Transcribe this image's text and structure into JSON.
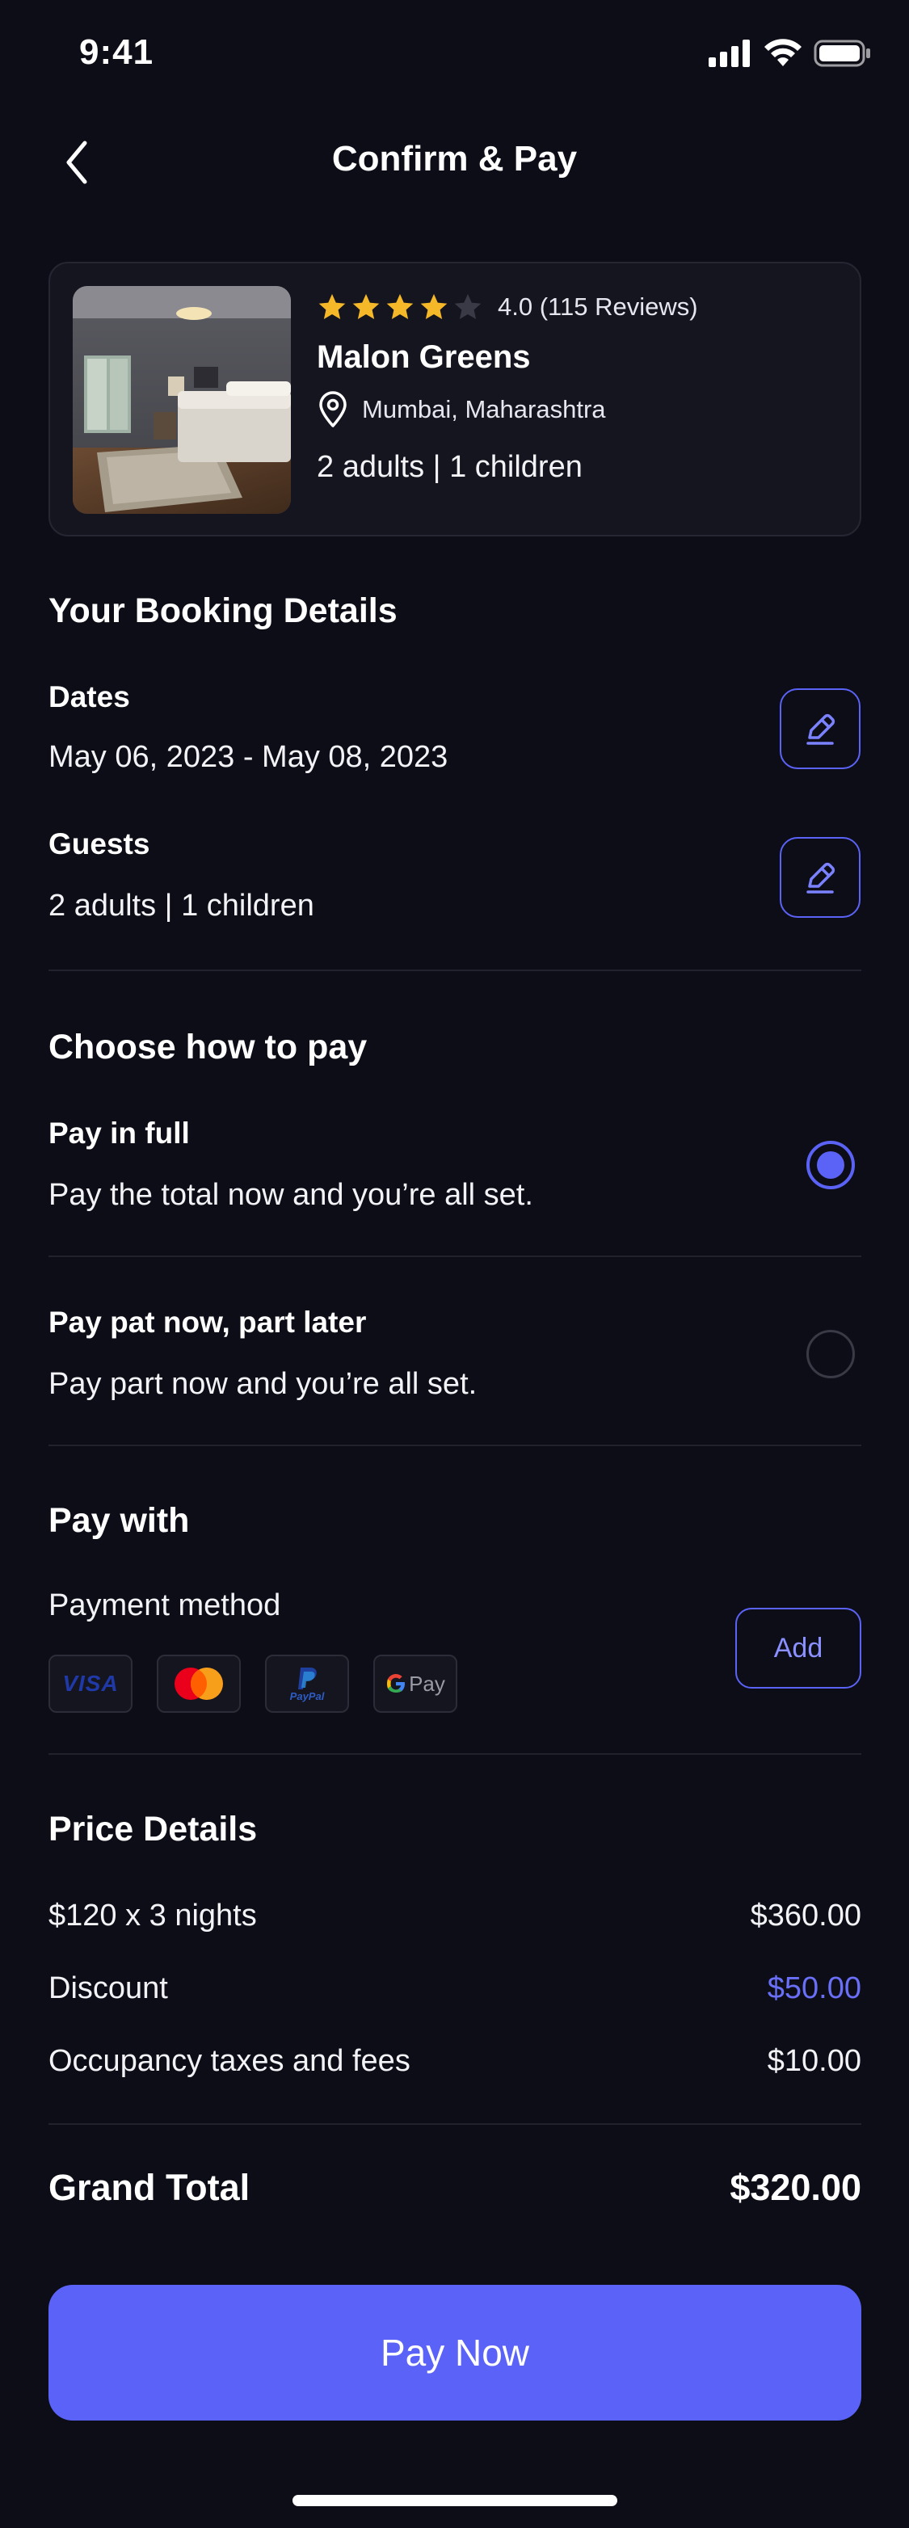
{
  "status": {
    "time": "9:41"
  },
  "nav": {
    "title": "Confirm & Pay"
  },
  "hotel": {
    "rating": 4.0,
    "stars_filled": 4,
    "stars_total": 5,
    "rating_text": "4.0 (115 Reviews)",
    "name": "Malon Greens",
    "location": "Mumbai, Maharashtra",
    "guests": "2 adults | 1 children"
  },
  "booking": {
    "title": "Your Booking Details",
    "dates_label": "Dates",
    "dates_value": "May 06, 2023 - May 08, 2023",
    "guests_label": "Guests",
    "guests_value": "2 adults | 1 children"
  },
  "payment_choice": {
    "title": "Choose how to pay",
    "options": [
      {
        "title": "Pay in full",
        "desc": "Pay the total now and you’re all set.",
        "selected": true
      },
      {
        "title": "Pay pat now, part later",
        "desc": "Pay part now and you’re all set.",
        "selected": false
      }
    ]
  },
  "pay_with": {
    "title": "Pay with",
    "method_label": "Payment method",
    "add_label": "Add",
    "card_visa": "VISA",
    "card_paypal_text": "PayPal",
    "card_gpay_text": "Pay",
    "cards": [
      "visa-icon",
      "mastercard-icon",
      "paypal-icon",
      "google-pay-icon"
    ]
  },
  "price": {
    "title": "Price Details",
    "rows": [
      {
        "label": "$120 x 3 nights",
        "value": "$360.00"
      },
      {
        "label": "Discount",
        "value": "$50.00"
      },
      {
        "label": "Occupancy taxes and fees",
        "value": "$10.00"
      }
    ],
    "grand_label": "Grand Total",
    "grand_value": "$320.00"
  },
  "cta": {
    "label": "Pay Now"
  },
  "colors": {
    "background": "#0d0d17",
    "accent": "#5a62f7",
    "star": "#f5b829"
  }
}
